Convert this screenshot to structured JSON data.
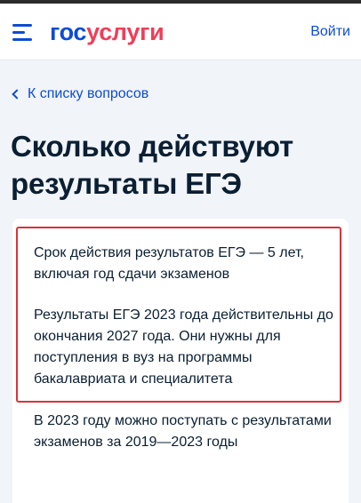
{
  "header": {
    "logo_part1": "гос",
    "logo_part2": "услуги",
    "login_label": "Войти"
  },
  "nav": {
    "back_label": "К списку вопросов"
  },
  "page": {
    "title": "Сколько действуют результаты ЕГЭ"
  },
  "answer": {
    "paragraphs": [
      "Срок действия результатов ЕГЭ — 5 лет, включая год сдачи экзаменов",
      "Результаты ЕГЭ 2023 года действительны до окончания 2027 года. Они нужны для поступления в вуз на программы бакалавриата и специалитета",
      "В 2023 году можно поступать с результатами экзаменов за 2019—2023 годы"
    ]
  },
  "colors": {
    "brand_blue": "#0d4cd3",
    "brand_red": "#ee3f58",
    "highlight_red": "#d8343a"
  },
  "icons": {
    "menu": "menu-icon",
    "back": "chevron-left-icon"
  }
}
